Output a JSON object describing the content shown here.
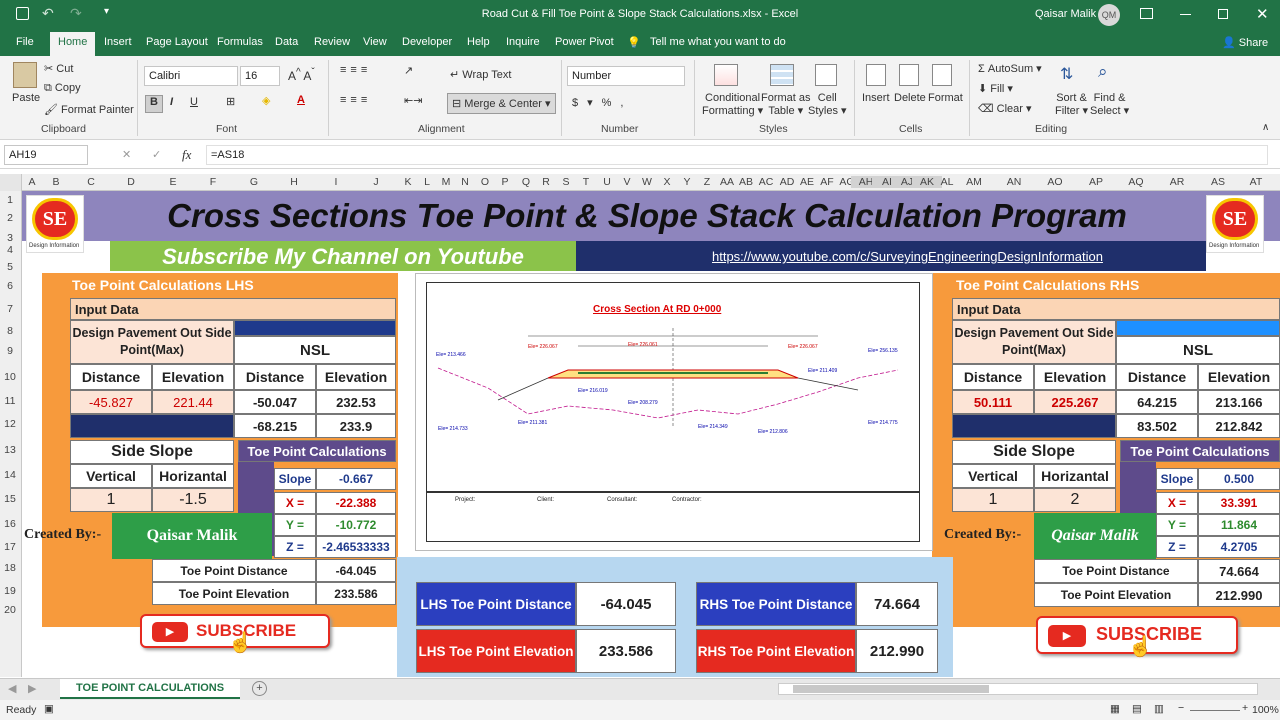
{
  "window": {
    "title": "Road Cut & Fill Toe Point & Slope Stack Calculations.xlsx  -  Excel",
    "user": "Qaisar Malik",
    "user_initials": "QM"
  },
  "tabs": [
    "File",
    "Home",
    "Insert",
    "Page Layout",
    "Formulas",
    "Data",
    "Review",
    "View",
    "Developer",
    "Help",
    "Inquire",
    "Power Pivot"
  ],
  "tell_me": "Tell me what you want to do",
  "share": "Share",
  "ribbon": {
    "paste": "Paste",
    "cut": "Cut",
    "copy": "Copy",
    "format_painter": "Format Painter",
    "clipboard": "Clipboard",
    "font_name": "Calibri",
    "font_size": "16",
    "font": "Font",
    "wrap_text": "Wrap Text",
    "merge_center": "Merge & Center",
    "alignment": "Alignment",
    "number_format": "Number",
    "number": "Number",
    "conditional": "Conditional",
    "formatting": "Formatting",
    "format_as": "Format as",
    "table": "Table",
    "cell": "Cell",
    "styles_lbl": "Styles",
    "styles": "Styles",
    "insert": "Insert",
    "delete": "Delete",
    "format": "Format",
    "cells": "Cells",
    "autosum": "AutoSum",
    "fill": "Fill",
    "clear": "Clear",
    "sort_filter": "Sort &",
    "filter": "Filter",
    "find_select": "Find &",
    "select": "Select",
    "editing": "Editing"
  },
  "formula_bar": {
    "name_box": "AH19",
    "formula": "=AS18"
  },
  "columns": [
    "A",
    "B",
    "C",
    "D",
    "E",
    "F",
    "G",
    "H",
    "I",
    "J",
    "K",
    "L",
    "M",
    "N",
    "O",
    "P",
    "Q",
    "R",
    "S",
    "T",
    "U",
    "V",
    "W",
    "X",
    "Y",
    "Z",
    "AA",
    "AB",
    "AC",
    "AD",
    "AE",
    "AF",
    "AG",
    "AH",
    "AI",
    "AJ",
    "AK",
    "AL",
    "AM",
    "AN",
    "AO",
    "AP",
    "AQ",
    "AR",
    "AS",
    "AT"
  ],
  "rows": [
    "1",
    "2",
    "3",
    "4",
    "5",
    "6",
    "7",
    "8",
    "9",
    "10",
    "11",
    "12",
    "13",
    "14",
    "15",
    "16",
    "17",
    "18",
    "19",
    "20"
  ],
  "sheet": {
    "main_title": "Cross Sections Toe Point & Slope Stack Calculation Program",
    "logo": "SE",
    "logo_sub": "Design Information",
    "subscribe_text": "Subscribe My Channel on Youtube",
    "channel_url": "https://www.youtube.com/c/SurveyingEngineeringDesignInformation",
    "lhs": {
      "header": "Toe Point Calculations LHS",
      "input": "Input Data",
      "design_label": "Design Pavement Out Side Point(Max)",
      "nsl": "NSL",
      "distance": "Distance",
      "elevation": "Elevation",
      "d_dist": "-45.827",
      "d_elev": "221.44",
      "nsl_rows": [
        [
          "-50.047",
          "232.53"
        ],
        [
          "-68.215",
          "233.9"
        ]
      ],
      "side_slope": "Side Slope",
      "vertical": "Vertical",
      "horizontal": "Horizantal",
      "v": "1",
      "h": "-1.5",
      "calc_title": "Toe Point Calculations",
      "slope_lbl": "Slope",
      "slope": "-0.667",
      "x_lbl": "X =",
      "x": "-22.388",
      "y_lbl": "Y =",
      "y": "-10.772",
      "z_lbl": "Z =",
      "z": "-2.46533333",
      "tp_dist_lbl": "Toe Point Distance",
      "tp_dist": "-64.045",
      "tp_elev_lbl": "Toe Point Elevation",
      "tp_elev": "233.586"
    },
    "rhs": {
      "header": "Toe Point Calculations RHS",
      "input": "Input Data",
      "design_label": "Design Pavement Out Side Point(Max)",
      "nsl": "NSL",
      "distance": "Distance",
      "elevation": "Elevation",
      "d_dist": "50.111",
      "d_elev": "225.267",
      "nsl_rows": [
        [
          "64.215",
          "213.166"
        ],
        [
          "83.502",
          "212.842"
        ]
      ],
      "side_slope": "Side Slope",
      "vertical": "Vertical",
      "horizontal": "Horizantal",
      "v": "1",
      "h": "2",
      "calc_title": "Toe Point Calculations",
      "slope_lbl": "Slope",
      "slope": "0.500",
      "x_lbl": "X =",
      "x": "33.391",
      "y_lbl": "Y =",
      "y": "11.864",
      "z_lbl": "Z =",
      "z": "4.2705",
      "tp_dist_lbl": "Toe Point  Distance",
      "tp_dist": "74.664",
      "tp_elev_lbl": "Toe Point  Elevation",
      "tp_elev": "212.990"
    },
    "created_by": "Created By:-",
    "author": "Qaisar Malik",
    "subscribe_btn": "SUBSCRIBE",
    "summary": {
      "lhs_dist_lbl": "LHS Toe Point Distance",
      "lhs_dist": "-64.045",
      "lhs_elev_lbl": "LHS Toe Point Elevation",
      "lhs_elev": "233.586",
      "rhs_dist_lbl": "RHS Toe Point Distance",
      "rhs_dist": "74.664",
      "rhs_elev_lbl": "RHS Toe Point Elevation",
      "rhs_elev": "212.990"
    },
    "drawing": {
      "title": "Cross Section At RD 0+000",
      "project": "Project:",
      "client": "Client:",
      "consultant": "Consultant:",
      "contractor": "Contractor:"
    }
  },
  "sheet_tab": "TOE POINT CALCULATIONS",
  "status": {
    "ready": "Ready",
    "zoom": "100%"
  },
  "colors": {
    "excel_green": "#217346",
    "title_band": "#8e85bd",
    "orange": "#f79a3c",
    "blue_dark": "#1f3a8c",
    "red": "#e52a20",
    "navy": "#1f2f6b",
    "green_bright": "#8bc34a"
  }
}
